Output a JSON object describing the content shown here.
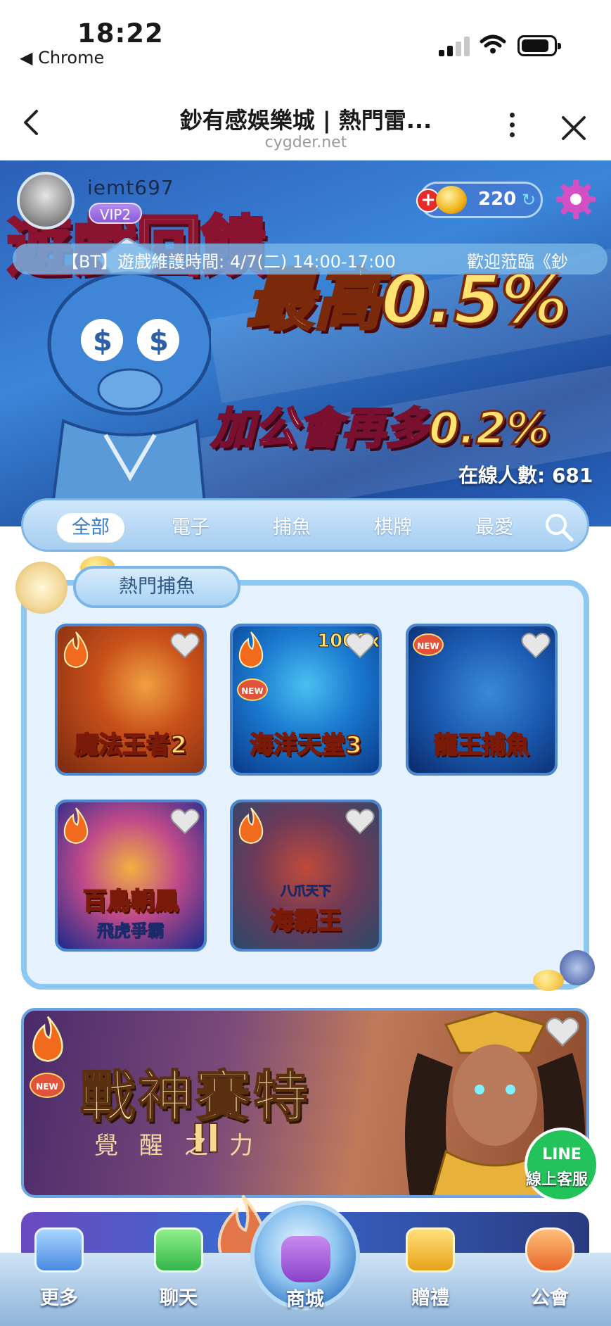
{
  "status_bar": {
    "time": "18:22",
    "back_app": "◀ Chrome"
  },
  "browser": {
    "title": "鈔有感娛樂城 | 熱門雷...",
    "url": "cygder.net"
  },
  "user": {
    "name": "iemt697",
    "vip": "VIP2",
    "coins": "220"
  },
  "banner": {
    "line1": "遊戲回饋",
    "line2": "最高0.5%",
    "line3_prefix": "加公會再多",
    "line3_value": "0.2%",
    "online": "在線人數: 681"
  },
  "marquee": {
    "text": "【BT】遊戲維護時間: 4/7(二) 14:00-17:00",
    "text2": "歡迎蒞臨《鈔"
  },
  "tabs": [
    {
      "label": "全部",
      "active": true
    },
    {
      "label": "電子"
    },
    {
      "label": "捕魚"
    },
    {
      "label": "棋牌"
    },
    {
      "label": "最愛"
    }
  ],
  "panel": {
    "title": "熱門捕魚"
  },
  "games": [
    {
      "name": "魔法王者2",
      "new": false,
      "colors": [
        "#7a2a10",
        "#c8501a",
        "#f0a040"
      ]
    },
    {
      "name": "海洋天堂3",
      "new": true,
      "banner_text": "1000x",
      "colors": [
        "#0a3a8a",
        "#1a7ad0",
        "#4ac0f0"
      ]
    },
    {
      "name": "龍王捕魚",
      "new": true,
      "colors": [
        "#0a2a6a",
        "#1a5ab0",
        "#3a8ad8"
      ]
    },
    {
      "name": "百鳥朝鳳",
      "sub": "飛虎爭霸",
      "new": false,
      "colors": [
        "#1a2a8a",
        "#c04a8a",
        "#f0b040"
      ]
    },
    {
      "name": "海霸王",
      "sub": "八爪天下",
      "new": false,
      "colors": [
        "#2a4a6a",
        "#6a3a5a",
        "#c04a3a"
      ]
    }
  ],
  "featured": {
    "name": "戰神賽特",
    "numeral": "II",
    "subtitle": "覺醒之力",
    "new": true
  },
  "support": {
    "logo": "LINE",
    "label": "線上客服"
  },
  "bottom_nav": [
    {
      "label": "更多"
    },
    {
      "label": "聊天"
    },
    {
      "label": "商城"
    },
    {
      "label": "贈禮"
    },
    {
      "label": "公會"
    }
  ]
}
